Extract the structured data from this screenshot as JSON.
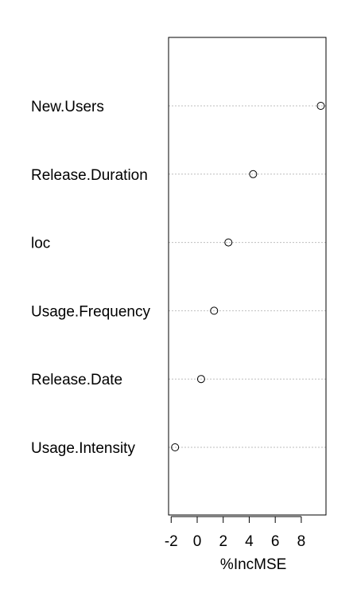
{
  "chart_data": {
    "type": "dotchart",
    "title": "",
    "xlabel": "%IncMSE",
    "ylabel": "",
    "xlim": [
      -2.2,
      9.9
    ],
    "x_ticks": [
      -2,
      0,
      2,
      4,
      6,
      8
    ],
    "x_tick_labels": [
      "-2",
      "0",
      "2",
      "4",
      "6",
      "8"
    ],
    "grid": "dotted horizontal guide lines",
    "categories": [
      "New.Users",
      "Release.Duration",
      "loc",
      "Usage.Frequency",
      "Release.Date",
      "Usage.Intensity"
    ],
    "values": [
      9.5,
      4.3,
      2.4,
      1.3,
      0.3,
      -1.7
    ]
  }
}
